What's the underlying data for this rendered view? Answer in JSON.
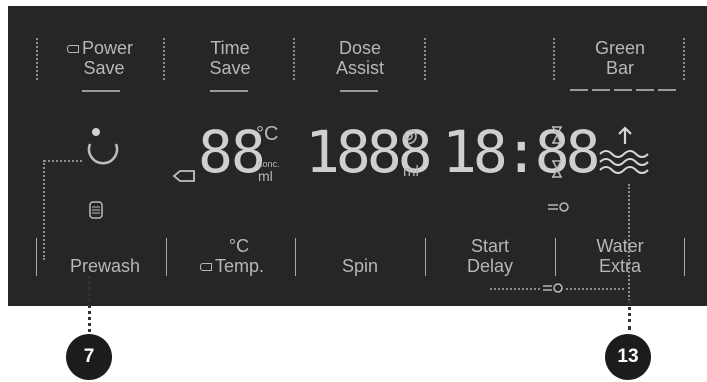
{
  "top_buttons": [
    {
      "name": "power-save-button",
      "line1": "Power",
      "line2": "Save"
    },
    {
      "name": "time-save-button",
      "line1": "Time",
      "line2": "Save"
    },
    {
      "name": "dose-assist-button",
      "line1": "Dose",
      "line2": "Assist"
    },
    {
      "name": "green-bar-button",
      "line1": "Green",
      "line2": "Bar"
    }
  ],
  "display": {
    "temp_digits": "88",
    "temp_unit": "°C",
    "conc_label": "conc.",
    "conc_unit": "ml",
    "spin_digits": "1888",
    "spin_unit": "ml",
    "time_digits": "18:88"
  },
  "bottom_buttons": [
    {
      "name": "prewash-button",
      "line1": "",
      "line2": "Prewash"
    },
    {
      "name": "temp-button",
      "line1": "°C",
      "line2": "Temp."
    },
    {
      "name": "spin-button",
      "line1": "",
      "line2": "Spin"
    },
    {
      "name": "start-delay-button",
      "line1": "Start",
      "line2": "Delay"
    },
    {
      "name": "water-extra-button",
      "line1": "Water",
      "line2": "Extra"
    }
  ],
  "callouts": {
    "left": "7",
    "right": "13"
  },
  "colors": {
    "panel": "#262626",
    "text": "#b7b7b7",
    "callout": "#1c1c1c"
  },
  "icons": [
    "key-icon",
    "power-icon",
    "detergent-icon",
    "spiral-icon",
    "hourglass-icon",
    "lock-icon",
    "water-waves-icon",
    "arrow-up-icon"
  ]
}
